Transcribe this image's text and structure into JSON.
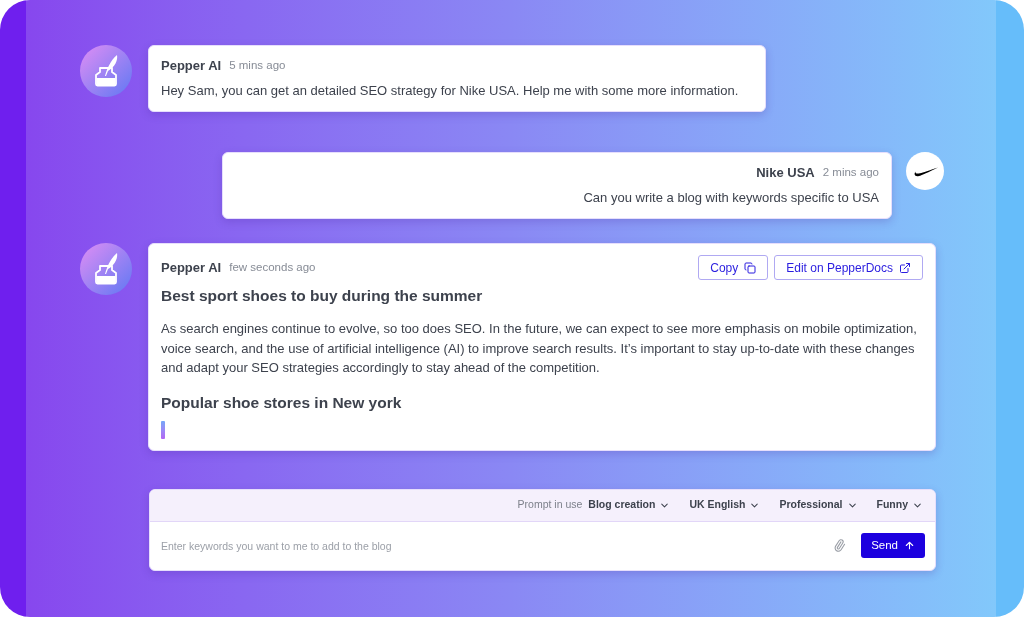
{
  "messages": [
    {
      "kind": "bot",
      "author": "Pepper AI",
      "time": "5 mins ago",
      "text": "Hey Sam, you can get an detailed SEO strategy for Nike USA. Help me with some more information.",
      "typing": false
    },
    {
      "kind": "user",
      "author": "Nike USA",
      "time": "2 mins ago",
      "text": "Can you write a blog with keywords specific to USA",
      "typing": false
    },
    {
      "kind": "bot",
      "author": "Pepper AI",
      "time": "few seconds ago",
      "actions": [
        {
          "kind": "copy",
          "label": "Copy"
        },
        {
          "kind": "open",
          "label": "Edit on PepperDocs"
        }
      ],
      "blocks": [
        {
          "kind": "heading",
          "text": "Best sport shoes to buy during the summer"
        },
        {
          "kind": "paragraph",
          "text": "As search engines continue to evolve, so too does SEO. In the future, we can expect to see more emphasis on mobile optimization, voice search, and the use of artificial intelligence (AI) to improve search results. It’s important to stay up-to-date with these changes and adapt your SEO strategies accordingly to stay ahead of the competition."
        },
        {
          "kind": "heading",
          "text": "Popular shoe stores in New york"
        }
      ],
      "typing": true
    }
  ],
  "composer": {
    "prompt_label": "Prompt in use",
    "options": [
      "Blog creation",
      "UK English",
      "Professional",
      "Funny"
    ],
    "placeholder": "Enter keywords you want to me to add to the blog",
    "send": "Send"
  }
}
